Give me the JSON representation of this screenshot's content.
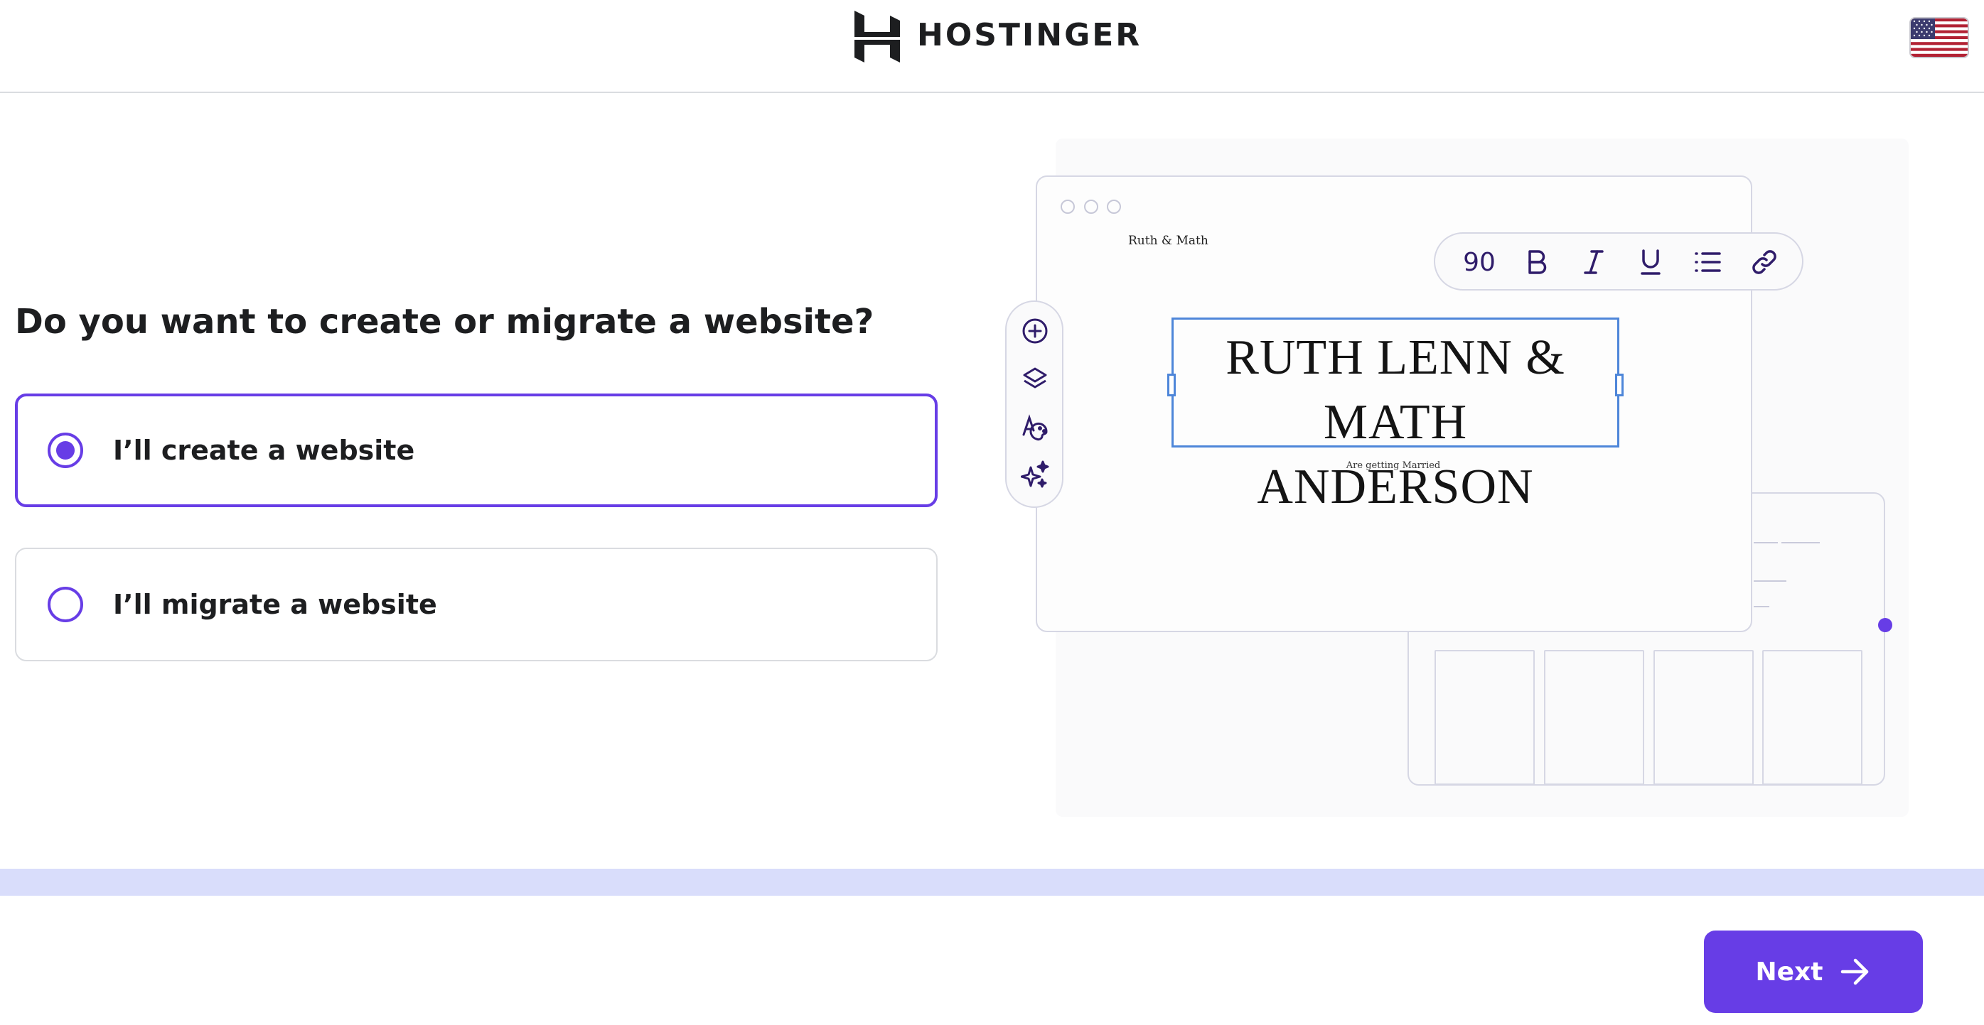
{
  "header": {
    "logo_text": "HOSTINGER",
    "logo_icon": "hostinger-h-logo",
    "language_flag": "us-flag-icon"
  },
  "question": "Do you want to create or migrate a website?",
  "options": [
    {
      "label": "I’ll create a website",
      "selected": true
    },
    {
      "label": "I’ll migrate a website",
      "selected": false
    }
  ],
  "illustration": {
    "site_name": "Ruth & Math",
    "title_line1": "RUTH LENN & MATH",
    "title_line2": "ANDERSON",
    "subtitle": "Are getting Married",
    "font_size_value": "90",
    "format_tools": [
      "bold-icon",
      "italic-icon",
      "underline-icon",
      "list-icon",
      "link-icon"
    ],
    "side_tools": [
      "add-icon",
      "layers-icon",
      "palette-icon",
      "sparkle-icon"
    ]
  },
  "footer": {
    "next_label": "Next",
    "next_icon": "arrow-right-icon"
  },
  "colors": {
    "accent": "#673de6",
    "progress_track": "#d9ddfb",
    "text": "#1d1e20",
    "selection_frame": "#4e86d9"
  }
}
